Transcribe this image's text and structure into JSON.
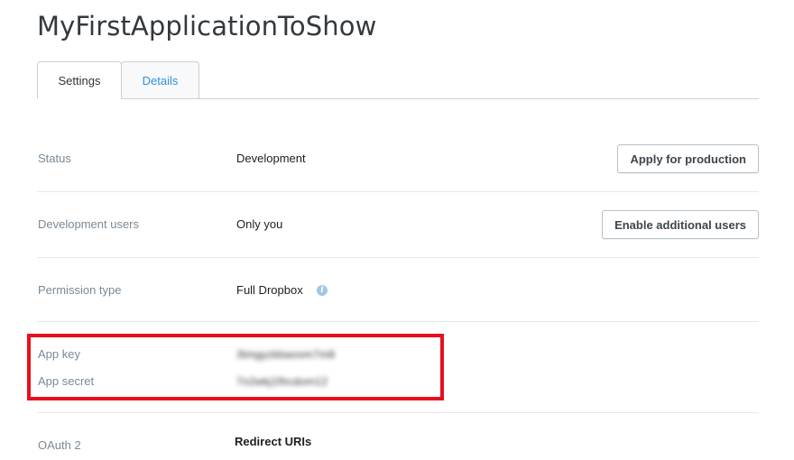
{
  "app": {
    "title": "MyFirstApplicationToShow"
  },
  "tabs": [
    {
      "label": "Settings",
      "active": true
    },
    {
      "label": "Details",
      "active": false
    }
  ],
  "settings": {
    "status": {
      "label": "Status",
      "value": "Development",
      "button": "Apply for production"
    },
    "dev_users": {
      "label": "Development users",
      "value": "Only you",
      "button": "Enable additional users"
    },
    "permission": {
      "label": "Permission type",
      "value": "Full Dropbox",
      "info_icon": "info-icon"
    },
    "app_key": {
      "label": "App key",
      "value": "3tmgyzkbaoom7m8"
    },
    "app_secret": {
      "label": "App secret",
      "value": "7n2wkj1fhcdom12"
    },
    "oauth": {
      "label": "OAuth 2",
      "value": "Redirect URIs"
    }
  },
  "colors": {
    "accent": "#3590d6",
    "highlight": "#e8101c",
    "label": "#7b8994",
    "divider": "#e6e9eb"
  }
}
